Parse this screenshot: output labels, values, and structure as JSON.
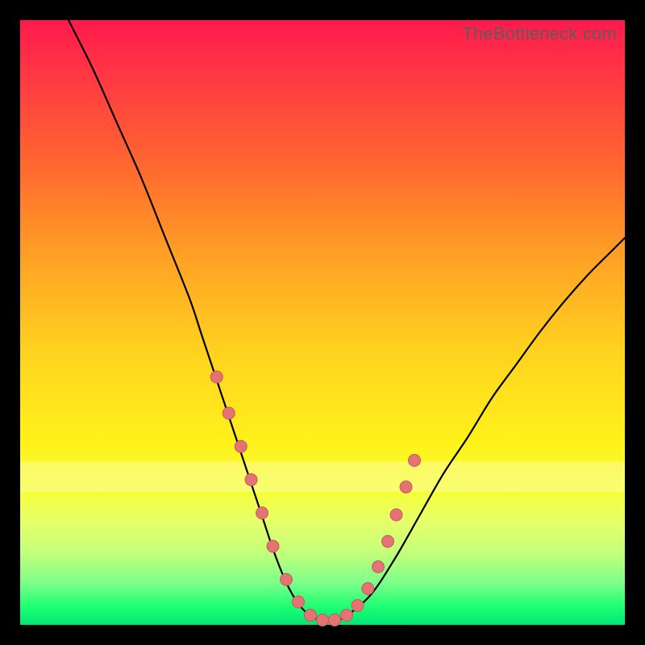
{
  "watermark": "TheBottleneck.com",
  "colors": {
    "curve_stroke": "#000000",
    "marker_fill": "#e57373",
    "marker_stroke": "#c25b5b",
    "band_fill": "#ffffff",
    "band_opacity": 0.28
  },
  "chart_data": {
    "type": "line",
    "title": "",
    "xlabel": "",
    "ylabel": "",
    "xlim": [
      0,
      100
    ],
    "ylim": [
      0,
      100
    ],
    "grid": false,
    "legend": false,
    "series": [
      {
        "name": "bottleneck-curve",
        "x": [
          8,
          12,
          16,
          20,
          24,
          28,
          30,
          32,
          34,
          36,
          38,
          40,
          42,
          44,
          46,
          48,
          50,
          52,
          54,
          58,
          62,
          66,
          70,
          74,
          78,
          82,
          86,
          90,
          94,
          98,
          100
        ],
        "y": [
          100,
          92,
          83,
          74,
          64,
          54,
          48,
          42,
          36,
          30,
          24,
          18,
          12,
          7,
          3.5,
          1.5,
          0.7,
          0.7,
          1.5,
          5,
          11,
          18,
          25,
          31,
          37.5,
          43,
          48.5,
          53.5,
          58,
          62,
          64
        ]
      }
    ],
    "markers": {
      "name": "highlight-points",
      "x": [
        32.5,
        34.5,
        36.5,
        38.2,
        40.0,
        41.8,
        44.0,
        46.0,
        48.0,
        50.0,
        52.0,
        54.0,
        55.8,
        57.5,
        59.2,
        60.8,
        62.2,
        63.8,
        65.2
      ],
      "y": [
        41,
        35,
        29.5,
        24,
        18.5,
        13,
        7.5,
        3.8,
        1.6,
        0.8,
        0.8,
        1.6,
        3.2,
        6.0,
        9.6,
        13.8,
        18.2,
        22.8,
        27.2
      ]
    },
    "band": {
      "name": "pale-highlight-band",
      "y_from": 22,
      "y_to": 27
    }
  }
}
